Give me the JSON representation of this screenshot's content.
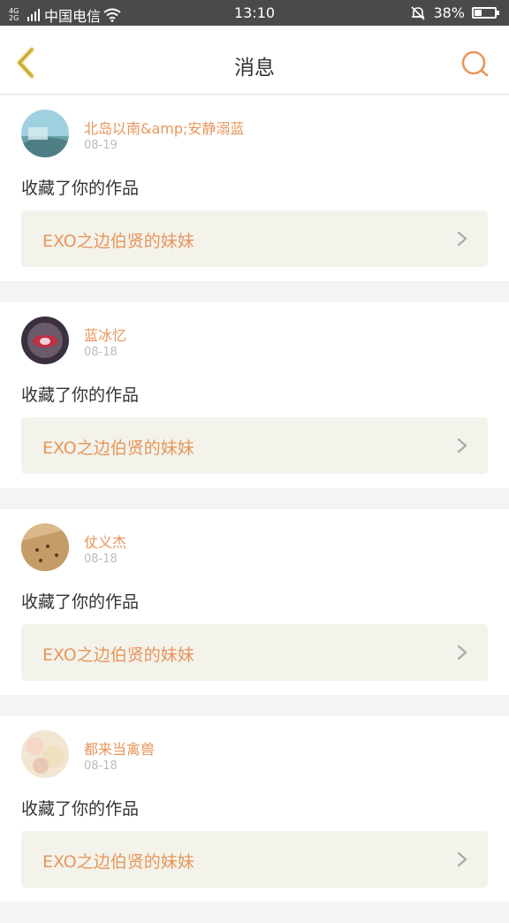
{
  "status_bar": {
    "network": "4G 2G",
    "carrier": "中国电信",
    "time": "13:10",
    "battery": "38%",
    "battery_level": 0.38
  },
  "header": {
    "title": "消息"
  },
  "colors": {
    "accent": "#e8955a",
    "back_icon": "#e3c74f",
    "card_link_bg": "#f3f3ec"
  },
  "messages": [
    {
      "user": "北岛以南&amp;安静溺蓝",
      "date": "08-19",
      "action": "收藏了你的作品",
      "work": "EXO之边伯贤的妹妹"
    },
    {
      "user": "蓝冰忆",
      "date": "08-18",
      "action": "收藏了你的作品",
      "work": "EXO之边伯贤的妹妹"
    },
    {
      "user": "仗义杰",
      "date": "08-18",
      "action": "收藏了你的作品",
      "work": "EXO之边伯贤的妹妹"
    },
    {
      "user": "都来当禽兽",
      "date": "08-18",
      "action": "收藏了你的作品",
      "work": "EXO之边伯贤的妹妹"
    }
  ]
}
